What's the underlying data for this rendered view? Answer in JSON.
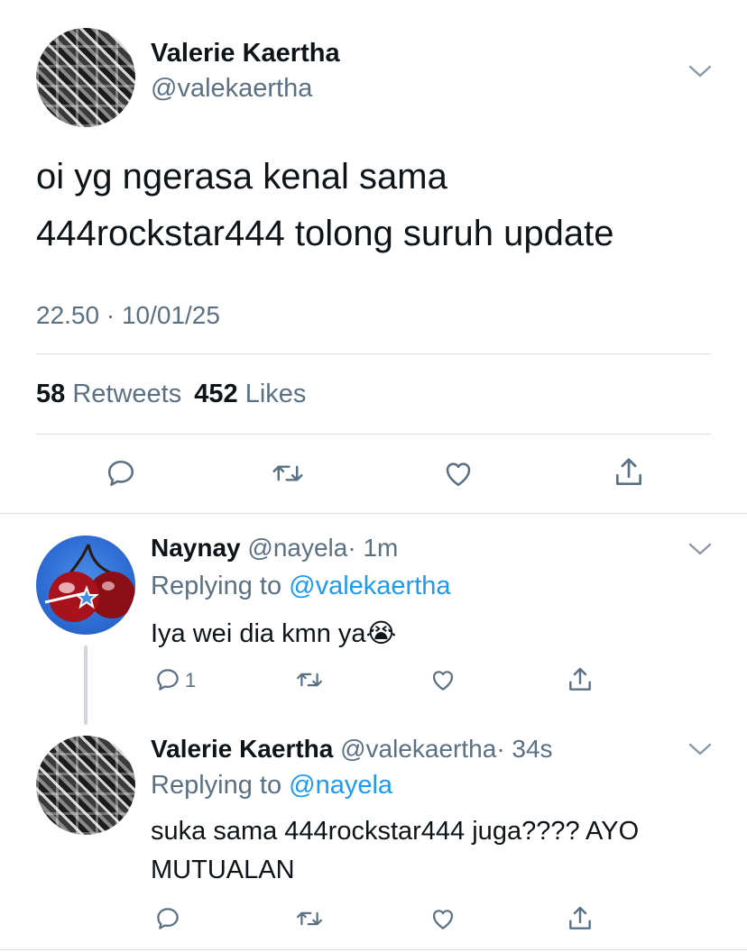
{
  "main_tweet": {
    "name": "Valerie Kaertha",
    "handle": "@valekaertha",
    "text_line1": "oi yg ngerasa kenal sama",
    "text_line2": "444rockstar444 tolong suruh update",
    "timestamp": "22.50 · 10/01/25",
    "retweets_count": "58",
    "retweets_label": "Retweets",
    "likes_count": "452",
    "likes_label": "Likes"
  },
  "replies": [
    {
      "name": "Naynay",
      "handle": "@nayela",
      "time": "· 1m",
      "replying_prefix": "Replying to",
      "replying_to": "@valekaertha",
      "text": "Iya wei dia kmn ya😭",
      "reply_count": "1"
    },
    {
      "name": "Valerie Kaertha",
      "handle": "@valekaertha",
      "time": "· 34s",
      "replying_prefix": "Replying to",
      "replying_to": "@nayela",
      "text_line1": "suka sama 444rockstar444 juga???? AYO",
      "text_line2": "MUTUALAN"
    }
  ],
  "colors": {
    "accent": "#1d9bf0",
    "muted": "#5b7083",
    "icon": "#5b7083",
    "divider": "#d9dee2"
  }
}
